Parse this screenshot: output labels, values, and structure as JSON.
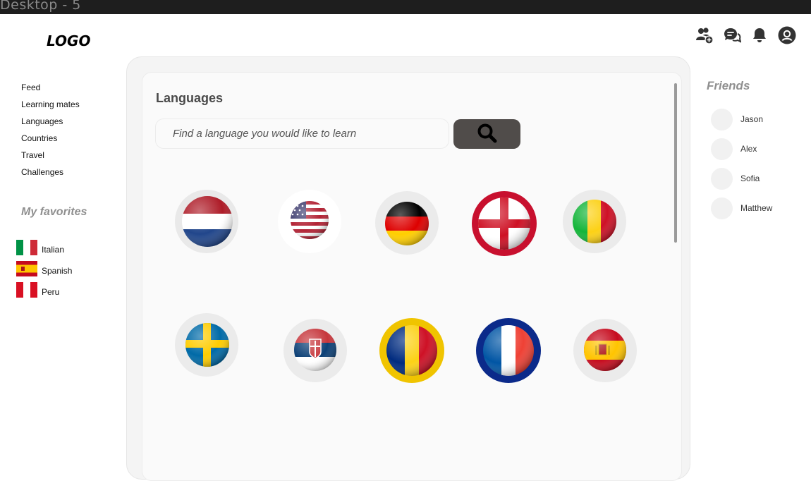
{
  "frame": {
    "title": "Desktop - 5"
  },
  "header": {
    "logo": "LOGO",
    "icons": [
      "add-friend-icon",
      "chat-icon",
      "bell-icon",
      "profile-icon"
    ]
  },
  "sidebar": {
    "nav": [
      {
        "label": "Feed"
      },
      {
        "label": "Learning mates"
      },
      {
        "label": "Languages"
      },
      {
        "label": "Countries"
      },
      {
        "label": "Travel"
      },
      {
        "label": "Challenges"
      }
    ],
    "favorites_title": "My favorites",
    "favorites": [
      {
        "label": "Italian",
        "flag": "italy-flag-icon"
      },
      {
        "label": "Spanish",
        "flag": "spain-flag-icon"
      },
      {
        "label": "Peru",
        "flag": "peru-flag-icon"
      }
    ]
  },
  "main": {
    "title": "Languages",
    "search": {
      "placeholder": "Find a language you would like to learn",
      "value": ""
    },
    "flags": [
      "netherlands-flag",
      "usa-flag",
      "germany-flag",
      "england-flag",
      "mali-flag",
      "sweden-flag",
      "serbia-flag",
      "romania-flag",
      "france-flag",
      "spain-flag"
    ]
  },
  "friends": {
    "title": "Friends",
    "list": [
      {
        "name": "Jason"
      },
      {
        "name": "Alex"
      },
      {
        "name": "Sofia"
      },
      {
        "name": "Matthew"
      }
    ]
  },
  "colors": {
    "search_button": "#504c4a",
    "muted_heading": "#8f8f8f",
    "frame_bar": "#1e1e1e"
  }
}
